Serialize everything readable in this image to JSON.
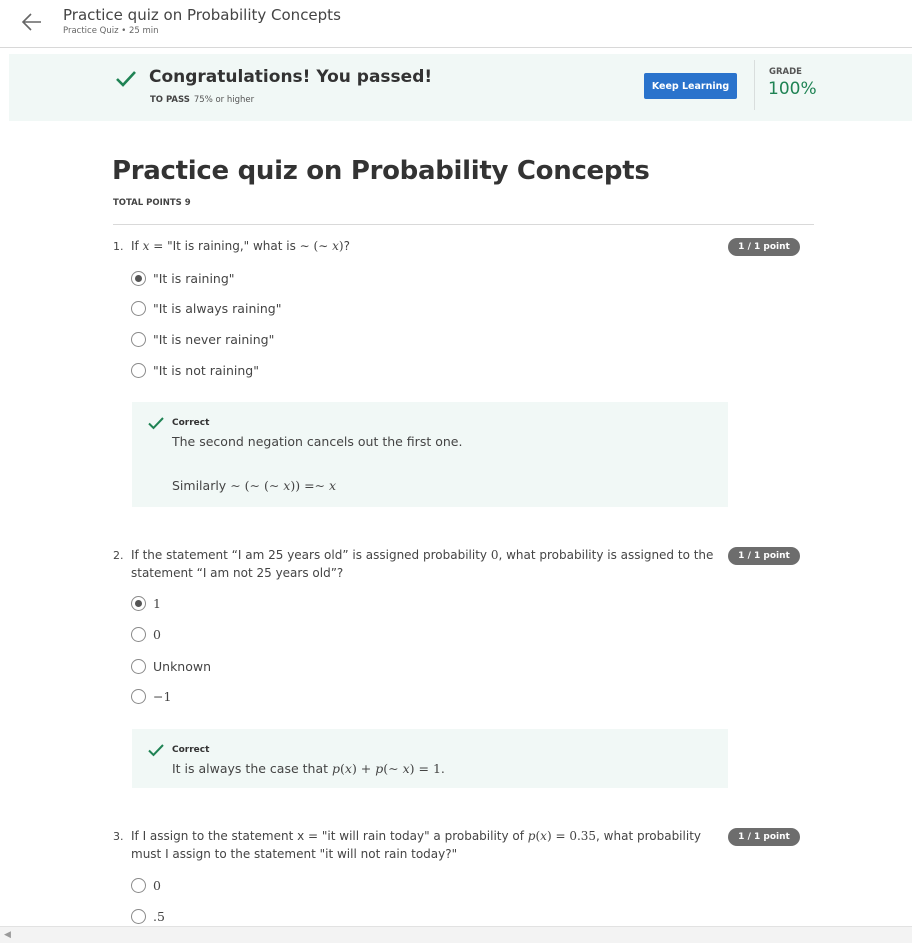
{
  "header": {
    "title": "Practice quiz on Probability Concepts",
    "subtitle": "Practice Quiz • 25 min"
  },
  "result": {
    "message": "Congratulations! You passed!",
    "to_pass_label": "TO PASS",
    "to_pass_value": "75% or higher",
    "keep_learning": "Keep Learning",
    "grade_label": "GRADE",
    "grade_value": "100%"
  },
  "quiz": {
    "title": "Practice quiz on Probability Concepts",
    "total_points": "TOTAL POINTS 9"
  },
  "questions": [
    {
      "number": "1.",
      "points": "1 / 1 point",
      "options": [
        "\"It is raining\"",
        "\"It is always raining\"",
        "\"It is never raining\"",
        "\"It is not raining\""
      ],
      "selected_index": 0,
      "feedback_label": "Correct",
      "feedback_line1": "The second negation cancels out the first one.",
      "feedback_line2_prefix": "Similarly "
    },
    {
      "number": "2.",
      "points": "1 / 1 point",
      "options": [
        "1",
        "0",
        "Unknown",
        "−1"
      ],
      "selected_index": 0,
      "feedback_label": "Correct",
      "feedback_prefix": "It is always the case that "
    },
    {
      "number": "3.",
      "points": "1 / 1 point",
      "options": [
        "0",
        ".5"
      ],
      "selected_index": -1
    }
  ],
  "icons": {
    "back": "arrow-left-icon",
    "passed": "check-icon",
    "scroll_left": "scroll-left-arrow-icon"
  },
  "colors": {
    "brand_blue": "#2a73cc",
    "success_green": "#1f8354",
    "band_bg": "#f1f8f6",
    "pill_gray": "#6d6d6d"
  }
}
